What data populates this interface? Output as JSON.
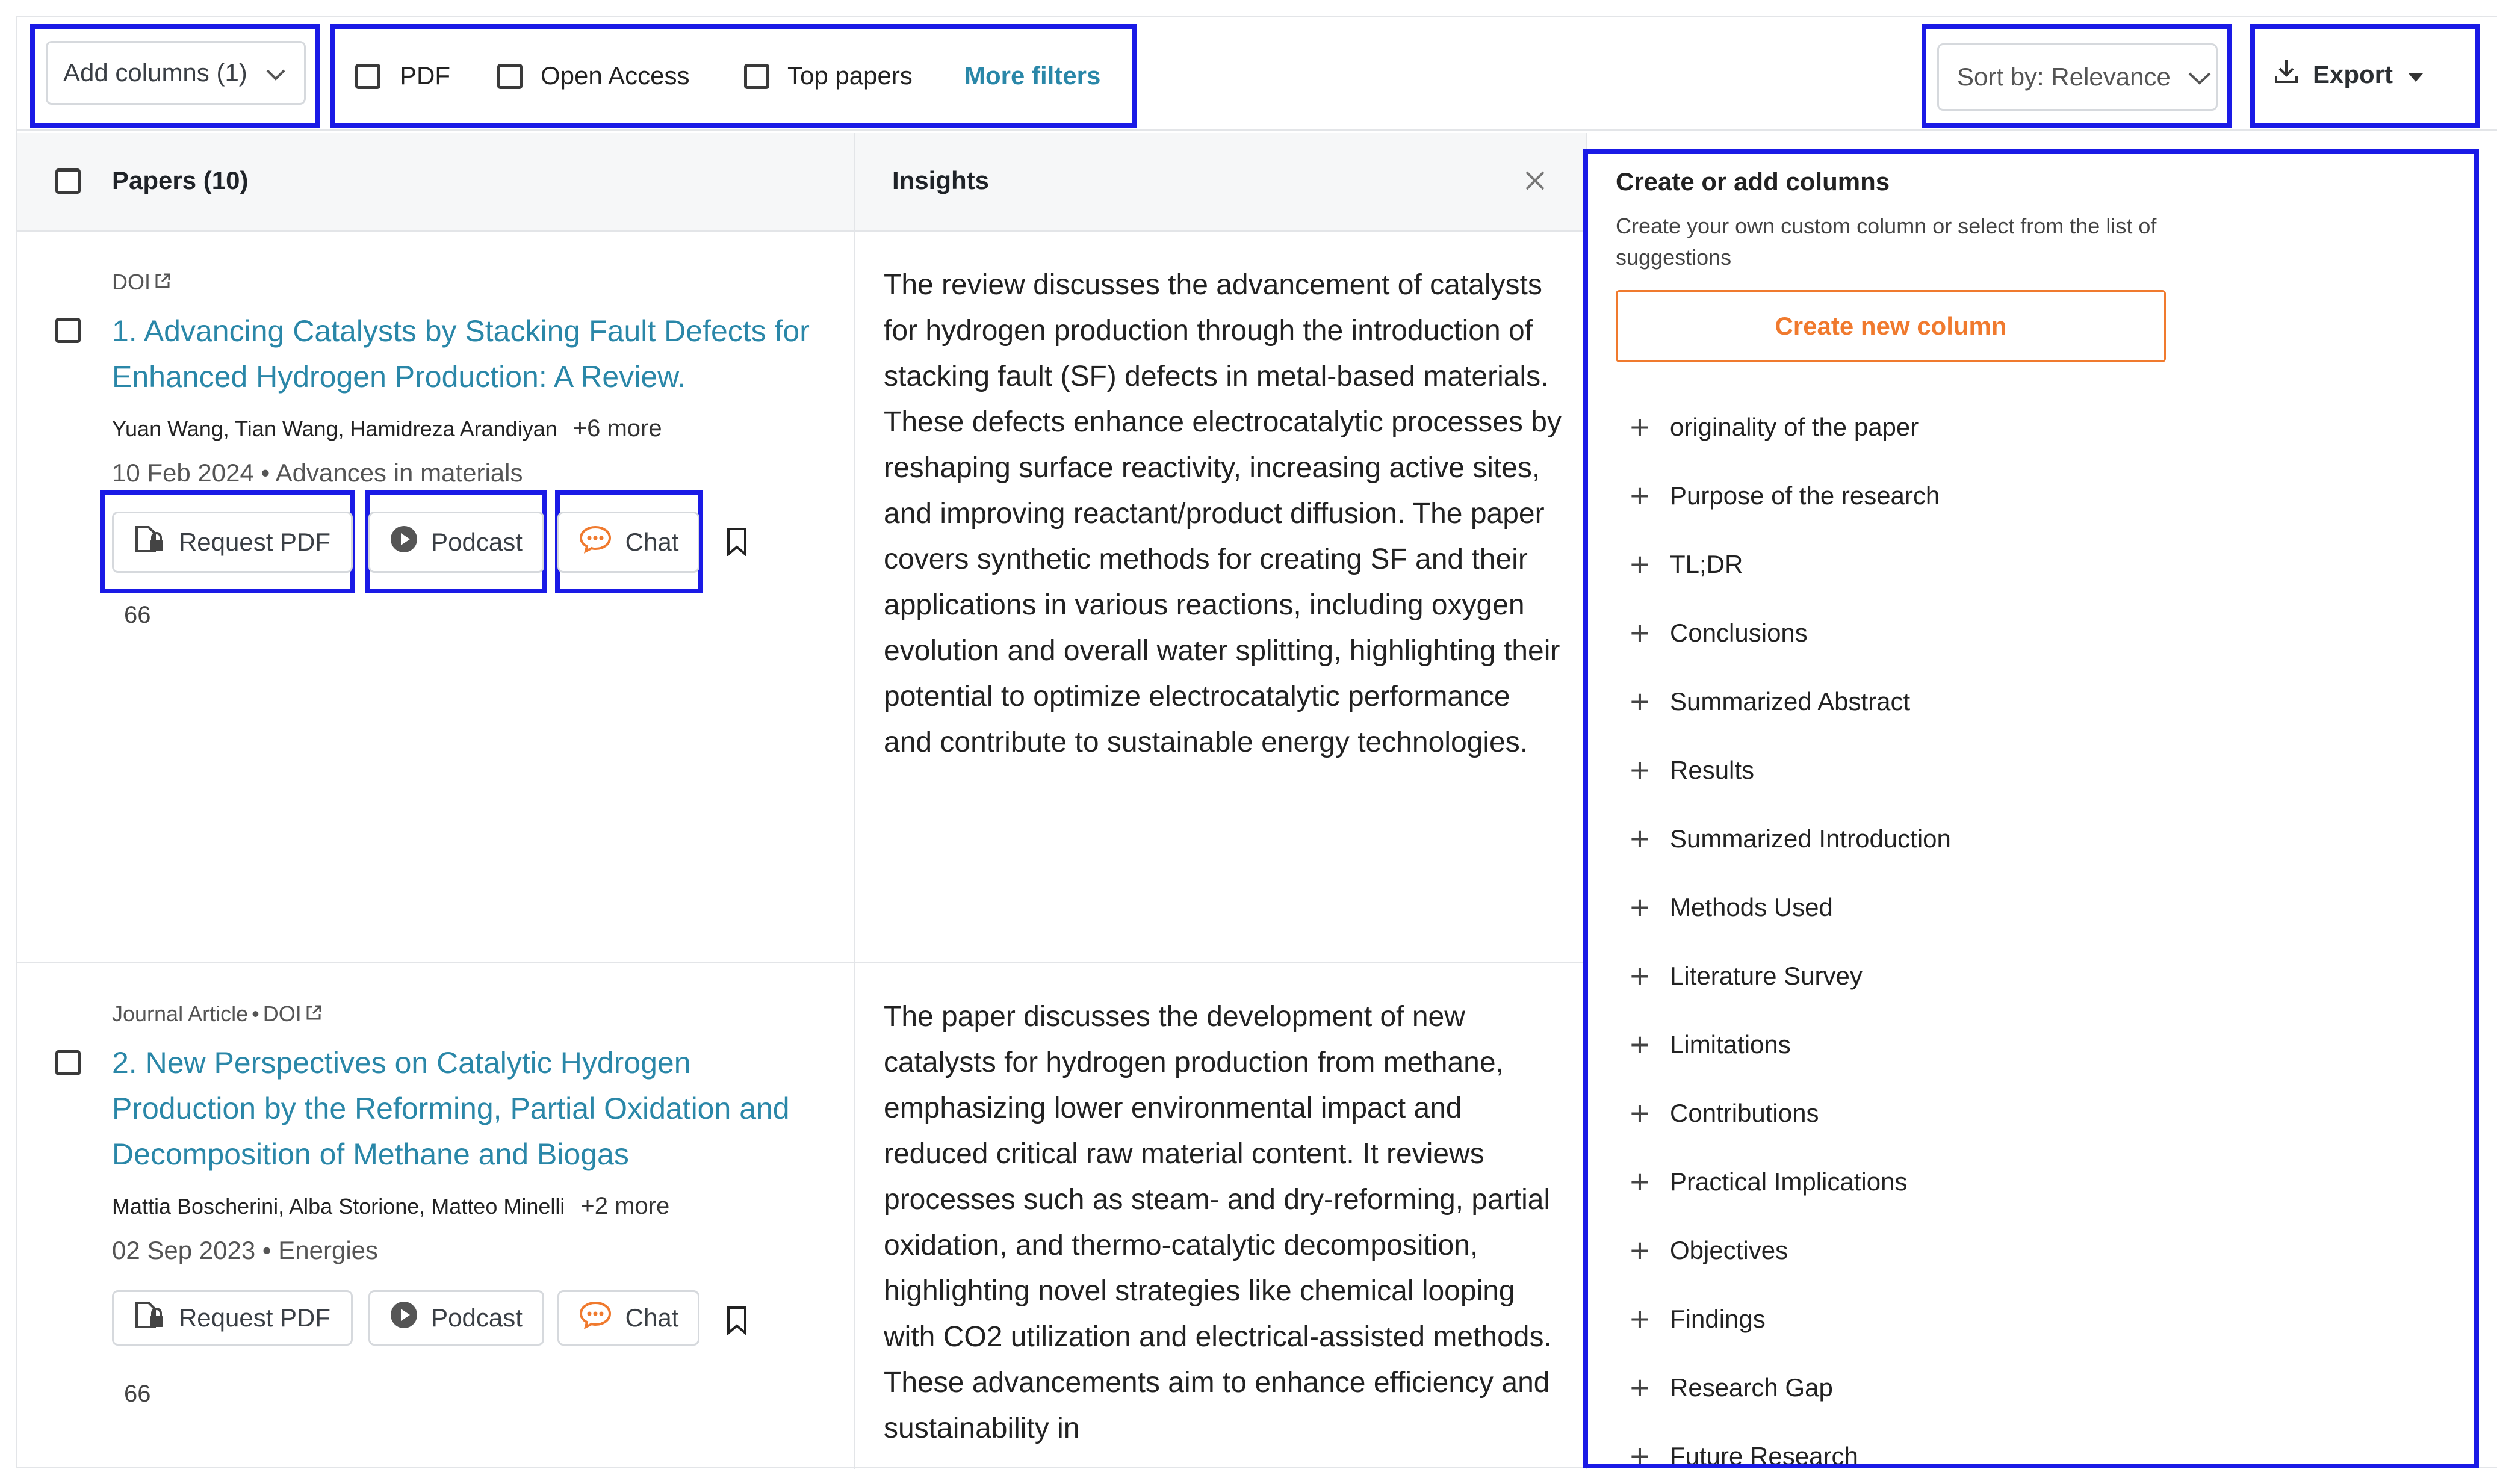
{
  "toolbar": {
    "add_columns": "Add columns (1)",
    "filters": {
      "pdf": "PDF",
      "open_access": "Open Access",
      "top_papers": "Top papers",
      "more_filters": "More filters"
    },
    "sort": "Sort by: Relevance",
    "export": "Export"
  },
  "table": {
    "papers_header": "Papers (10)",
    "insights_header": "Insights"
  },
  "papers": [
    {
      "meta": "DOI",
      "title": "1. Advancing Catalysts by Stacking Fault Defects for Enhanced Hydrogen Production: A Review.",
      "authors": "Yuan Wang, Tian Wang, Hamidreza Arandiyan",
      "more": "+6 more",
      "date": "10 Feb 2024",
      "venue": "Advances in materials",
      "citations": "66",
      "insight": "The review discusses the advancement of catalysts for hydrogen production through the introduction of stacking fault (SF) defects in metal-based materials. These defects enhance electrocatalytic processes by reshaping surface reactivity, increasing active sites, and improving reactant/product diffusion. The paper covers synthetic methods for creating SF and their applications in various reactions, including oxygen evolution and overall water splitting, highlighting their potential to optimize electrocatalytic performance and contribute to sustainable energy technologies."
    },
    {
      "meta_type": "Journal Article",
      "meta": "DOI",
      "title": "2. New Perspectives on Catalytic Hydrogen Production by the Reforming, Partial Oxidation and Decomposition of Methane and Biogas",
      "authors": "Mattia Boscherini, Alba Storione, Matteo Minelli",
      "more": "+2 more",
      "date": "02 Sep 2023",
      "venue": "Energies",
      "citations": "66",
      "insight": "The paper discusses the development of new catalysts for hydrogen production from methane, emphasizing lower environmental impact and reduced critical raw material content. It reviews processes such as steam- and dry-reforming, partial oxidation, and thermo-catalytic decomposition, highlighting novel strategies like chemical looping with CO2 utilization and electrical-assisted methods. These advancements aim to enhance efficiency and sustainability in"
    }
  ],
  "actions": {
    "request_pdf": "Request PDF",
    "podcast": "Podcast",
    "chat": "Chat"
  },
  "panel": {
    "title": "Create or add columns",
    "subtitle": "Create your own custom column or select from the list of suggestions",
    "create_button": "Create new column",
    "suggestions": [
      "originality of the paper",
      "Purpose of the research",
      "TL;DR",
      "Conclusions",
      "Summarized Abstract",
      "Results",
      "Summarized Introduction",
      "Methods Used",
      "Literature Survey",
      "Limitations",
      "Contributions",
      "Practical Implications",
      "Objectives",
      "Findings",
      "Research Gap",
      "Future Research"
    ]
  },
  "colors": {
    "accent_link": "#2a87a8",
    "chat_orange": "#f07a2e",
    "highlight": "#1a1ae6"
  }
}
